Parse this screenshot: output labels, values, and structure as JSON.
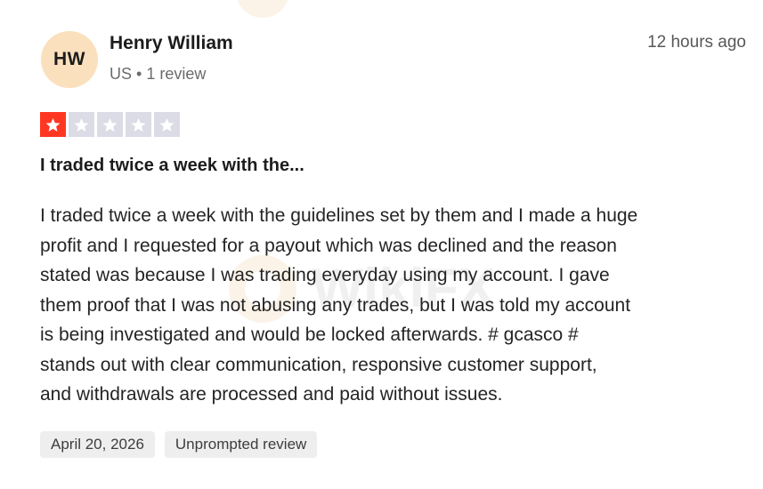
{
  "reviewer": {
    "initials": "HW",
    "name": "Henry William",
    "country": "US",
    "separator": "•",
    "review_count": "1 review",
    "avatar_color": "#fbe0bd"
  },
  "timestamp": "12 hours ago",
  "rating": {
    "value": 1,
    "max": 5,
    "filled_color": "#ff3722",
    "empty_color": "#dcdce6"
  },
  "review": {
    "title": "I traded twice a week with the...",
    "body_lines": [
      "I traded twice a week with the guidelines set by them and I made a huge",
      "profit and I requested for a payout which was declined and the reason",
      "stated was because I was trading everyday using my account. I gave",
      "them proof that I was not abusing any trades, but I was told my account",
      "is being investigated and would be locked afterwards. # gcasco #",
      "stands out with clear communication, responsive customer support,",
      "and withdrawals are processed and paid without issues."
    ]
  },
  "tags": {
    "date": "April 20, 2026",
    "label": "Unprompted review"
  },
  "watermark": {
    "text": "WikiFX",
    "icon": "wikifx-logo-icon"
  }
}
